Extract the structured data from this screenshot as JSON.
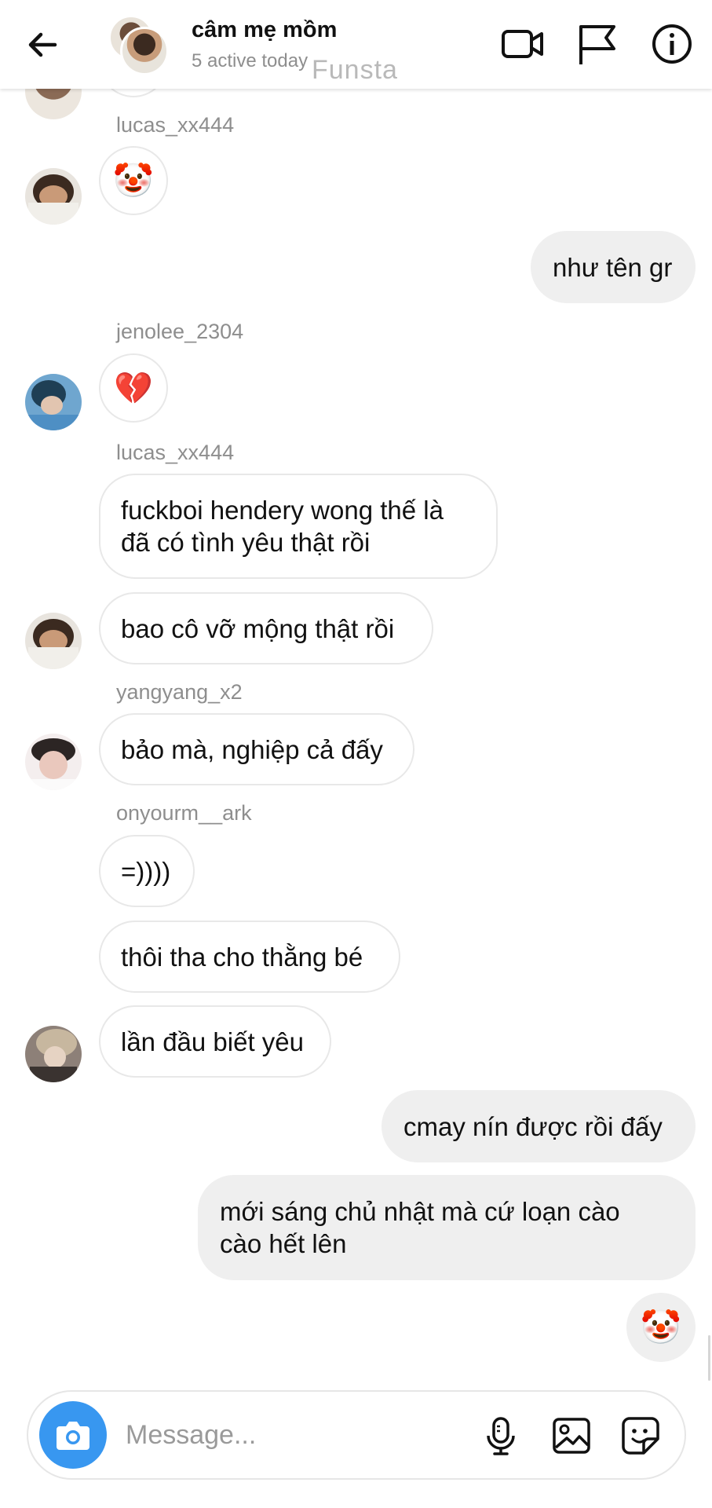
{
  "header": {
    "title": "câm mẹ mồm",
    "subtitle": "5 active today",
    "watermark": "Funsta"
  },
  "icons": {
    "back": "arrow-left-icon",
    "video": "video-camera-icon",
    "report": "flag-icon",
    "info": "info-icon",
    "camera": "camera-icon",
    "mic": "microphone-icon",
    "gallery": "image-icon",
    "sticker": "sticker-icon"
  },
  "messages": {
    "m1_user": "lucas_xx444",
    "m1_emoji": "🤡",
    "m2_text": "như tên gr",
    "m3_user": "jenolee_2304",
    "m3_emoji": "💔",
    "m4_user": "lucas_xx444",
    "m4_text": "fuckboi hendery wong thế là\nđã có tình yêu thật rồi",
    "m5_text": "bao cô vỡ mộng thật rồi",
    "m6_user": "yangyang_x2",
    "m6_text": "bảo mà, nghiệp cả đấy",
    "m7_user": "onyourm__ark",
    "m7_text": "=))))",
    "m8_text": "thôi tha cho thằng bé",
    "m9_text": "lần đầu biết yêu",
    "m10_text": "cmay nín được rồi đấy",
    "m11_text": "mới sáng chủ nhật mà cứ loạn cào\ncào hết lên",
    "m12_emoji": "🤡"
  },
  "composer": {
    "placeholder": "Message..."
  },
  "colors": {
    "accent": "#3897f0",
    "incoming_bubble": "#ffffff",
    "outgoing_bubble": "#efefef",
    "muted_text": "#8e8e8e"
  }
}
